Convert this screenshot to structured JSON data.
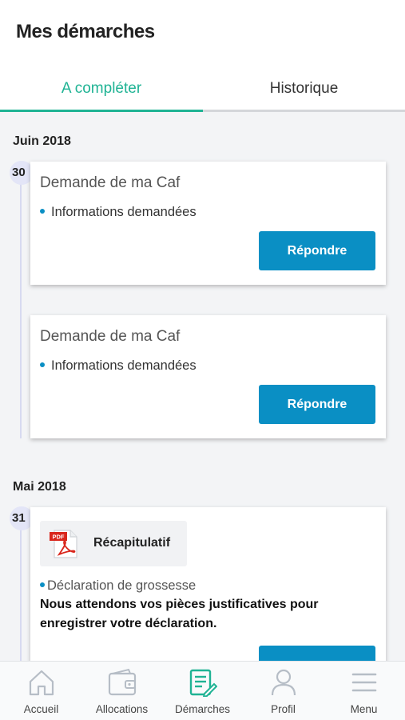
{
  "header": {
    "title": "Mes démarches"
  },
  "tabs": [
    {
      "label": "A compléter",
      "active": true
    },
    {
      "label": "Historique",
      "active": false
    }
  ],
  "groups": [
    {
      "month": "Juin 2018",
      "day": "30",
      "cards": [
        {
          "title": "Demande de ma Caf",
          "item": "Informations demandées",
          "button": "Répondre"
        },
        {
          "title": "Demande de ma Caf",
          "item": "Informations demandées",
          "button": "Répondre"
        }
      ]
    },
    {
      "month": "Mai 2018",
      "day": "31",
      "cards": [
        {
          "attachment": "Récapitulatif",
          "attachment_icon": "pdf-icon",
          "item": "Déclaration de grossesse",
          "text": "Nous attendons vos pièces justificatives pour enregistrer votre déclaration."
        }
      ]
    }
  ],
  "bottom_nav": [
    {
      "label": "Accueil",
      "icon": "home-icon",
      "active": false
    },
    {
      "label": "Allocations",
      "icon": "wallet-icon",
      "active": false
    },
    {
      "label": "Démarches",
      "icon": "document-edit-icon",
      "active": true
    },
    {
      "label": "Profil",
      "icon": "user-icon",
      "active": false
    },
    {
      "label": "Menu",
      "icon": "hamburger-menu-icon",
      "active": false
    }
  ],
  "colors": {
    "accent": "#1fb394",
    "button": "#0a8fc4",
    "nav_inactive": "#b6bdc6"
  }
}
